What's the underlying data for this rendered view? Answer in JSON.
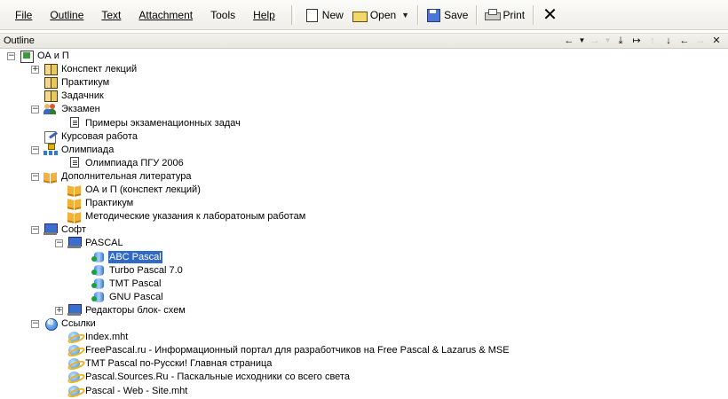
{
  "menu": [
    {
      "label": "File",
      "name": "menu-file"
    },
    {
      "label": "Outline",
      "name": "menu-outline"
    },
    {
      "label": "Text",
      "name": "menu-text"
    },
    {
      "label": "Attachment",
      "name": "menu-attachment"
    },
    {
      "label": "Tools",
      "name": "menu-tools"
    },
    {
      "label": "Help",
      "name": "menu-help"
    }
  ],
  "toolbar": {
    "new_label": "New",
    "open_label": "Open",
    "save_label": "Save",
    "print_label": "Print",
    "close_glyph": "✕"
  },
  "outline": {
    "title": "Outline"
  },
  "tree": [
    {
      "label": "ОА и П",
      "icon": "root-icon",
      "expander": "−"
    },
    {
      "label": "Конспект лекций",
      "icon": "book-icon",
      "expander": "+"
    },
    {
      "label": "Практикум",
      "icon": "book-icon",
      "expander": ""
    },
    {
      "label": "Задачник",
      "icon": "book-icon",
      "expander": ""
    },
    {
      "label": "Экзамен",
      "icon": "people-icon",
      "expander": "−"
    },
    {
      "label": "Примеры экзаменационных задач",
      "icon": "document-icon",
      "expander": ""
    },
    {
      "label": "Курсовая работа",
      "icon": "pen-icon",
      "expander": ""
    },
    {
      "label": "Олимпиада",
      "icon": "org-chart-icon",
      "expander": "−"
    },
    {
      "label": "Олимпиада ПГУ 2006",
      "icon": "document-icon",
      "expander": ""
    },
    {
      "label": "Дополнительная литература",
      "icon": "open-book-icon",
      "expander": "−"
    },
    {
      "label": "ОА и П (конспект лекций)",
      "icon": "open-book-icon",
      "expander": ""
    },
    {
      "label": "Практикум",
      "icon": "open-book-icon",
      "expander": ""
    },
    {
      "label": "Методические указания к лаборатоным работам",
      "icon": "open-book-icon",
      "expander": ""
    },
    {
      "label": "Софт",
      "icon": "computer-icon",
      "expander": "−"
    },
    {
      "label": "PASCAL",
      "icon": "computer-icon",
      "expander": "−"
    },
    {
      "label": "ABC Pascal",
      "icon": "database-icon",
      "expander": "",
      "selected": true
    },
    {
      "label": "Turbo Pascal 7.0",
      "icon": "database-icon",
      "expander": ""
    },
    {
      "label": "TMT Pascal",
      "icon": "database-icon",
      "expander": ""
    },
    {
      "label": "GNU Pascal",
      "icon": "database-icon",
      "expander": ""
    },
    {
      "label": "Редакторы блок- схем",
      "icon": "computer-icon",
      "expander": "+"
    },
    {
      "label": "Ссылки",
      "icon": "globe-icon",
      "expander": "−"
    },
    {
      "label": "Index.mht",
      "icon": "ie-icon",
      "expander": ""
    },
    {
      "label": "FreePascal.ru - Информационный портал для разработчиков на Free Pascal & Lazarus & MSE",
      "icon": "ie-icon",
      "expander": ""
    },
    {
      "label": "TMT Pascal по-Русски! Главная страница",
      "icon": "ie-icon",
      "expander": ""
    },
    {
      "label": "Pascal.Sources.Ru - Паскальные исходники со всего света",
      "icon": "ie-icon",
      "expander": ""
    },
    {
      "label": "Pascal - Web - Site.mht",
      "icon": "ie-icon",
      "expander": ""
    }
  ],
  "colors": {
    "selection": "#316ac5",
    "toolbar_bg": "#efeee9"
  }
}
